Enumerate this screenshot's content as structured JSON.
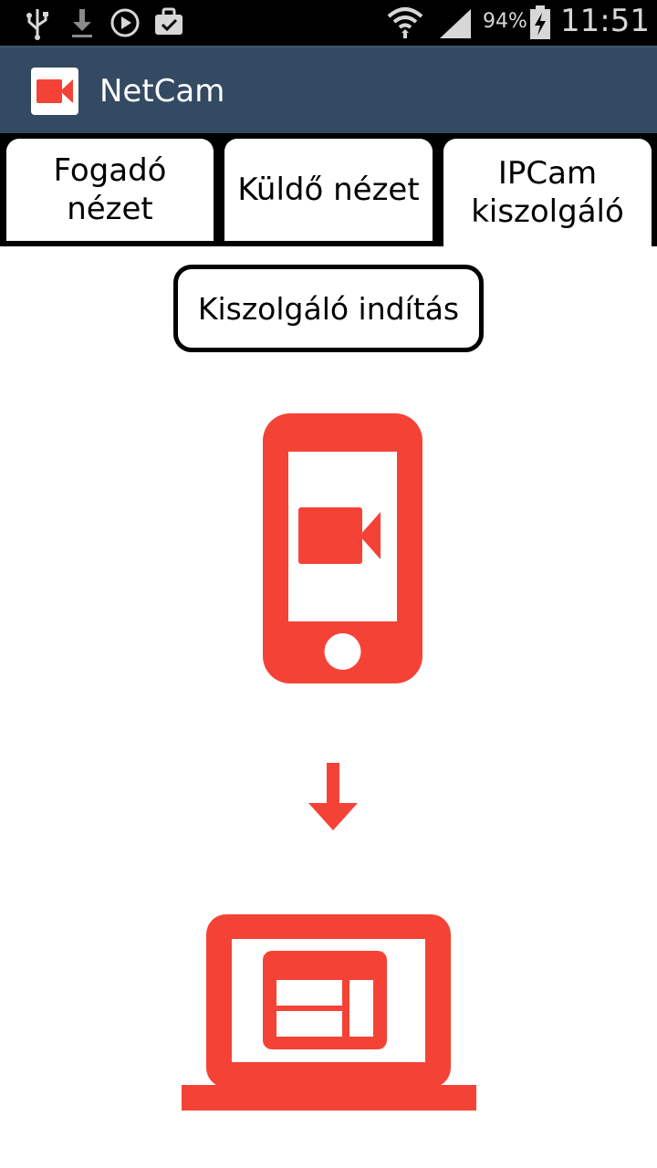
{
  "status_bar": {
    "battery": "94%",
    "time": "11:51",
    "icons": [
      "usb-icon",
      "download-icon",
      "play-icon",
      "briefcase-icon",
      "wifi-icon",
      "signal-icon",
      "battery-charging-icon"
    ]
  },
  "app": {
    "title": "NetCam",
    "icon": "video-camera-icon"
  },
  "tabs": [
    {
      "line1": "Fogadó",
      "line2": "nézet",
      "active": false
    },
    {
      "line1": "Küldő nézet",
      "line2": "",
      "active": false
    },
    {
      "line1": "IPCam",
      "line2": "kiszolgáló",
      "active": true
    }
  ],
  "main": {
    "start_button_label": "Kiszolgáló indítás",
    "illustration": [
      "phone-camera-icon",
      "arrow-down-icon",
      "laptop-browser-icon"
    ]
  },
  "colors": {
    "accent": "#f44336",
    "action_bar": "#334a62",
    "status_bar": "#000000"
  }
}
